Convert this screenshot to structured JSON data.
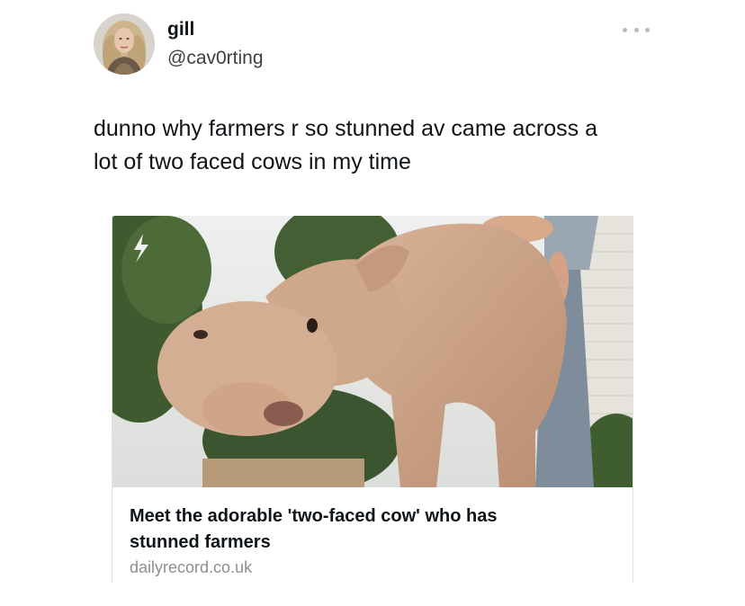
{
  "tweet": {
    "author": {
      "display_name": "gill",
      "handle": "@cav0rting",
      "avatar": "profile-photo-avatar"
    },
    "more_icon": "more-horizontal-icon",
    "text": "dunno why farmers r so stunned av came across a\nlot of two faced cows in my time"
  },
  "link_card": {
    "image": "two-faced-calf-photo",
    "title": "Meet the adorable 'two-faced cow' who has\nstunned farmers",
    "domain": "dailyrecord.co.uk"
  },
  "colors": {
    "text_primary": "#0f1419",
    "text_secondary": "#3c4043",
    "domain_gray": "#8b9095",
    "card_border": "#dfe3e6"
  }
}
